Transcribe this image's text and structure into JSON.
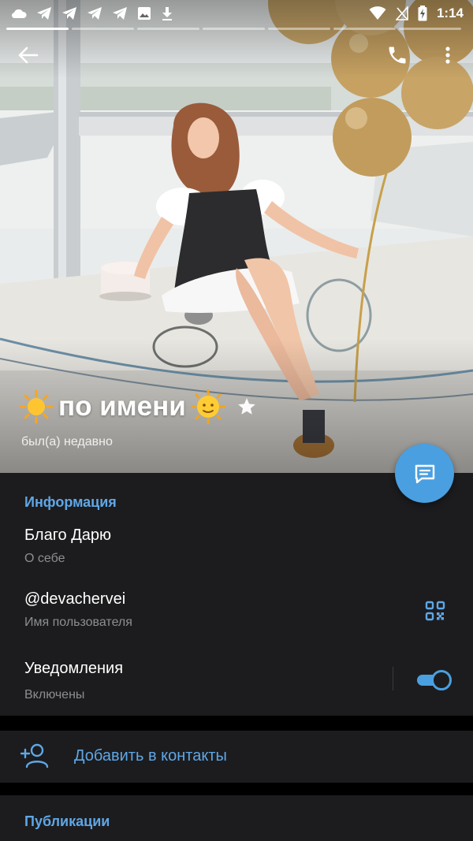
{
  "status_bar": {
    "time": "1:14",
    "left_icons": [
      "cloud-icon",
      "telegram-icon",
      "telegram-icon",
      "telegram-icon",
      "telegram-icon",
      "image-icon",
      "download-icon"
    ],
    "right_icons": [
      "wifi-icon",
      "no-signal-icon",
      "battery-charging-icon"
    ]
  },
  "toolbar": {
    "back_icon": "arrow-left-icon",
    "call_icon": "phone-icon",
    "more_icon": "more-vertical-icon"
  },
  "story_segments": {
    "count": 5,
    "active_index": 0
  },
  "profile": {
    "name": "по имени",
    "name_prefix_emoji": "sun-icon",
    "name_suffix_emoji": "sun-with-face-icon",
    "badge_icon": "star-icon",
    "last_seen": "был(а) недавно"
  },
  "fab": {
    "icon": "message-icon"
  },
  "info": {
    "section_title": "Информация",
    "bio": {
      "value": "Благо Дарю",
      "label": "О себе"
    },
    "username": {
      "value": "@devachervei",
      "label": "Имя пользователя",
      "icon": "qr-code-icon"
    },
    "notifications": {
      "value": "Уведомления",
      "label": "Включены",
      "enabled": true
    }
  },
  "add_contact": {
    "label": "Добавить в контакты",
    "icon": "add-user-icon"
  },
  "publications": {
    "section_title": "Публикации"
  },
  "colors": {
    "accent": "#5fa7e6",
    "fab": "#4a9fe0",
    "surface": "#1c1c1e",
    "background": "#000000",
    "secondary_text": "#8d8e90"
  }
}
